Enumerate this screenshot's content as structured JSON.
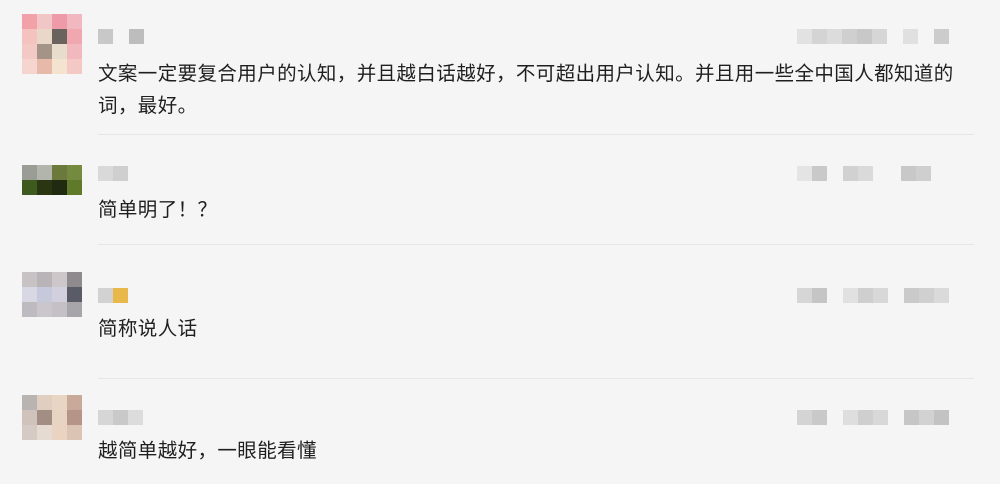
{
  "comments": [
    {
      "text": "文案一定要复合用户的认知，并且越白话越好，不可超出用户认知。并且用一些全中国人都知道的词，最好。"
    },
    {
      "text": "简单明了！？"
    },
    {
      "text": "简称说人话"
    },
    {
      "text": "越简单越好，一眼能看懂"
    }
  ],
  "colors": {
    "background": "#f5f5f5",
    "text": "#1f1f1f",
    "divider": "#e6e6e6",
    "mosaic_accent": "#e8b94a"
  }
}
